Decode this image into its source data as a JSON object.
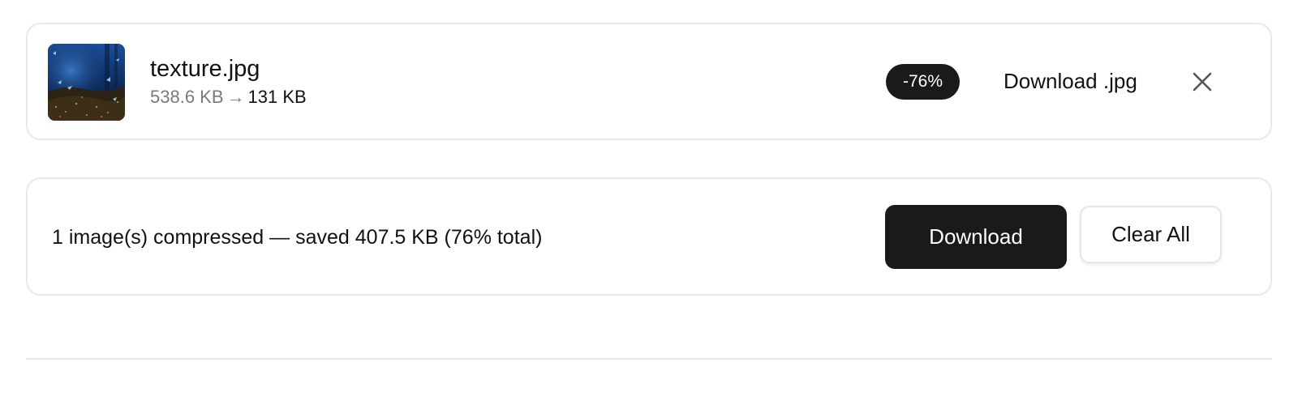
{
  "file": {
    "name": "texture.jpg",
    "size_before": "538.6 KB",
    "arrow": "→",
    "size_after": "131 KB",
    "reduction_badge": "-76%",
    "download_label": "Download .jpg",
    "thumbnail_icon": "image-thumbnail"
  },
  "summary": {
    "text": "1 image(s) compressed — saved 407.5 KB (76% total)",
    "download_button": "Download",
    "clear_button": "Clear All"
  },
  "colors": {
    "accent_dark": "#1a1a1a",
    "muted_text": "#7a7a7a",
    "border": "#e8e8e8"
  }
}
